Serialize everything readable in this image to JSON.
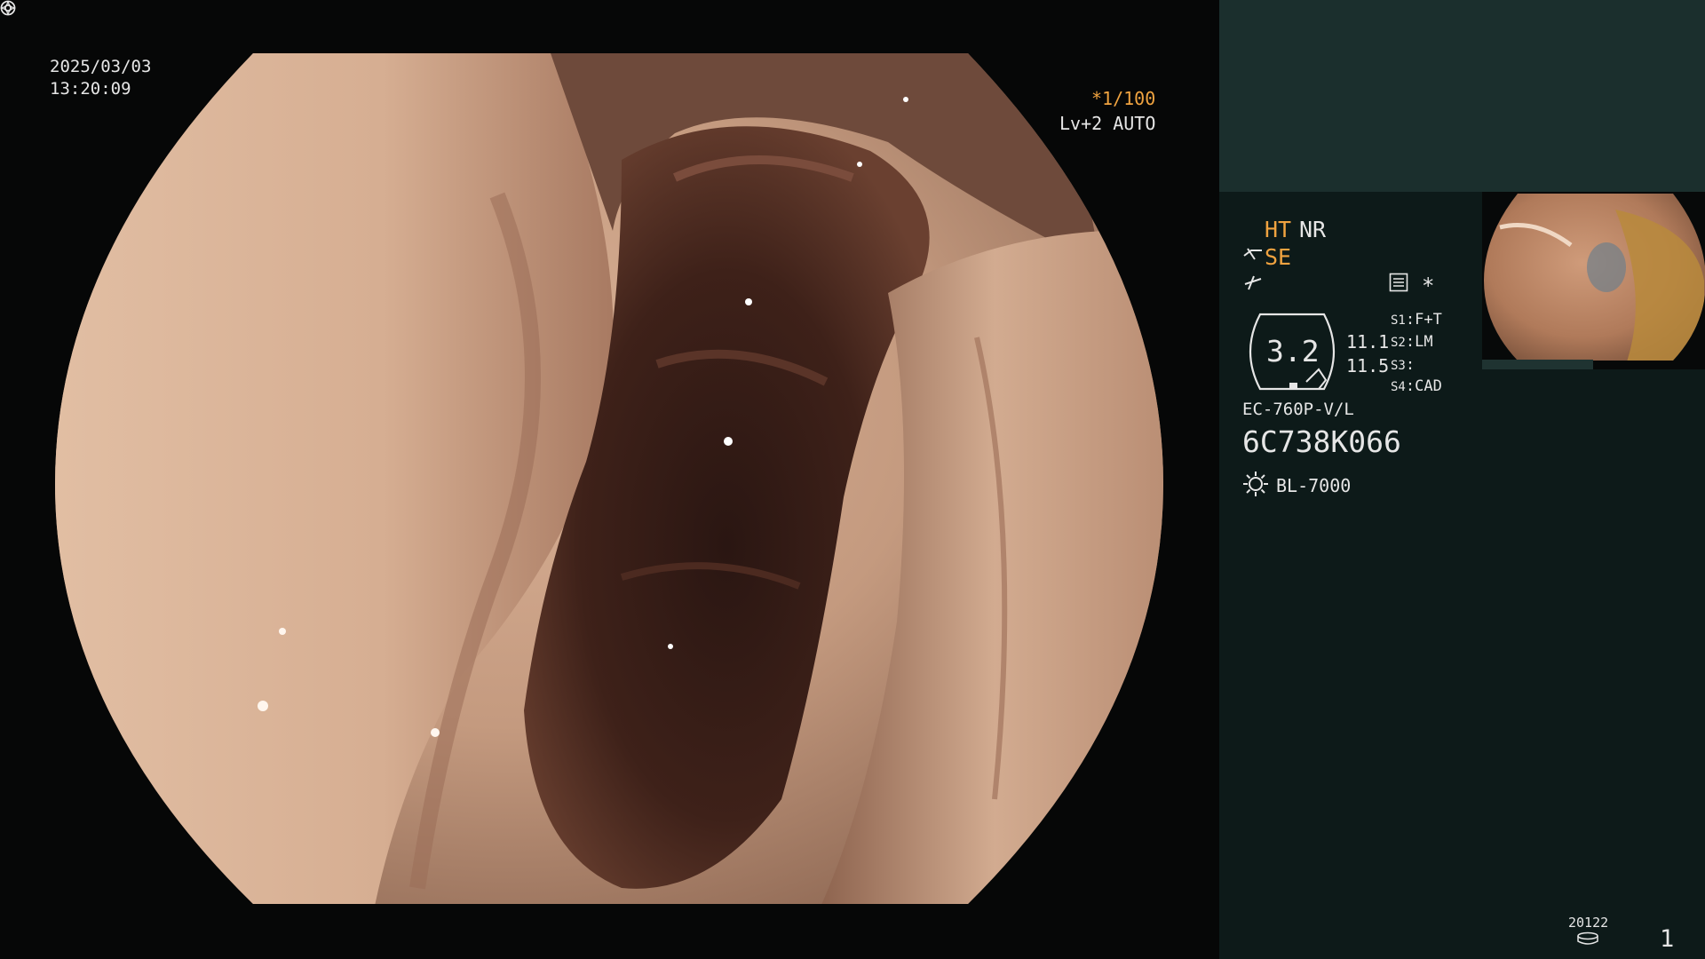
{
  "overlay": {
    "date": "2025/03/03",
    "time": "13:20:09",
    "shutter": "*1/100",
    "level": "Lv+2 AUTO"
  },
  "panel": {
    "ht": "HT",
    "nr": "NR",
    "se": "SE",
    "asterisk": "*",
    "zoom": "3.2",
    "value_1": "11.1",
    "value_2": "11.5",
    "switches": [
      {
        "label": "S1",
        "value": "F+T"
      },
      {
        "label": "S2",
        "value": "LM"
      },
      {
        "label": "S3",
        "value": ""
      },
      {
        "label": "S4",
        "value": "CAD"
      }
    ],
    "scope_model": "EC-760P-V/L",
    "scope_serial": "6C738K066",
    "light_source": "BL-7000",
    "counter": "20122",
    "page_number": "1"
  },
  "colors": {
    "accent_orange": "#f0a340",
    "panel_bg": "#0d1a19",
    "panel_top_bg": "#1b2f2d"
  }
}
